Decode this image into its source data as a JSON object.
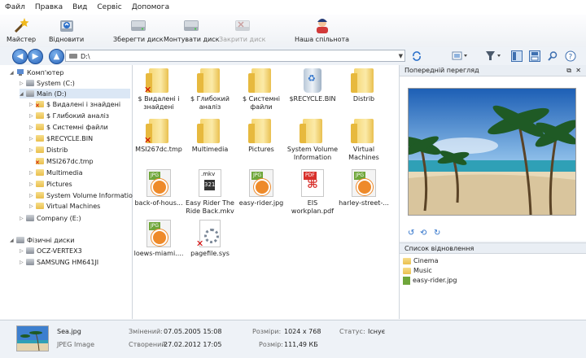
{
  "menu": [
    "Файл",
    "Правка",
    "Вид",
    "Сервіс",
    "Допомога"
  ],
  "toolbar": {
    "wizard": "Майстер",
    "restore": "Відновити",
    "save_disk": "Зберегти диск",
    "mount_disk": "Монтувати диск",
    "close_disk": "Закрити диск",
    "community": "Наша спільнота"
  },
  "address": {
    "path": "D:\\"
  },
  "tree": {
    "computer": "Комп'ютер",
    "system_c": "System (C:)",
    "main_d": "Main (D:)",
    "folders": [
      "$ Видалені і знайдені",
      "$ Глибокий аналіз",
      "$ Системні файли",
      "$RECYCLE.BIN",
      "Distrib",
      "MSI267dc.tmp",
      "Multimedia",
      "Pictures",
      "System Volume Information",
      "Virtual Machines"
    ],
    "company_e": "Company (E:)",
    "physical": "Фізичні диски",
    "disk1": "OCZ-VERTEX3",
    "disk2": "SAMSUNG HM641JI"
  },
  "files": [
    {
      "name": "$ Видалені і знайдені",
      "kind": "folder-deleted"
    },
    {
      "name": "$ Глибокий аналіз",
      "kind": "folder"
    },
    {
      "name": "$ Системні файли",
      "kind": "folder"
    },
    {
      "name": "$RECYCLE.BIN",
      "kind": "bin"
    },
    {
      "name": "Distrib",
      "kind": "folder"
    },
    {
      "name": "MSI267dc.tmp",
      "kind": "folder-deleted"
    },
    {
      "name": "Multimedia",
      "kind": "folder"
    },
    {
      "name": "Pictures",
      "kind": "folder"
    },
    {
      "name": "System Volume Information",
      "kind": "folder"
    },
    {
      "name": "Virtual Machines",
      "kind": "folder"
    },
    {
      "name": "back-of-hous...",
      "kind": "jpg"
    },
    {
      "name": "Easy Rider The Ride Back.mkv",
      "kind": "mkv"
    },
    {
      "name": "easy-rider.jpg",
      "kind": "jpg"
    },
    {
      "name": "EIS workplan.pdf",
      "kind": "pdf"
    },
    {
      "name": "harley-street-...",
      "kind": "jpg"
    },
    {
      "name": "loews-miami....",
      "kind": "jpg"
    },
    {
      "name": "pagefile.sys",
      "kind": "sys"
    }
  ],
  "icon_tags": {
    "jpg": "JPG",
    "pdf": "PDF",
    "mkv": ".mkv"
  },
  "preview": {
    "title": "Попередній перегляд"
  },
  "restore_list": {
    "title": "Список відновлення",
    "items": [
      "Cinema",
      "Music",
      "easy-rider.jpg"
    ]
  },
  "status": {
    "filename": "Sea.jpg",
    "filetype": "JPEG Image",
    "modified_label": "Змінений:",
    "modified_value": "07.05.2005 15:08",
    "created_label": "Створений:",
    "created_value": "27.02.2012 17:05",
    "size_label": "Розміри:",
    "size_value": "1024 x 768",
    "filesize_label": "Розмір:",
    "filesize_value": "111,49 КБ",
    "state_label": "Статус:",
    "state_value": "Існує"
  }
}
